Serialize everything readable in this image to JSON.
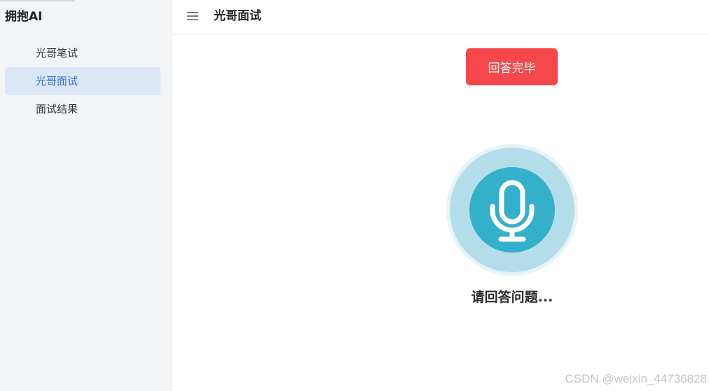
{
  "sidebar": {
    "brand": "拥抱AI",
    "items": [
      {
        "label": "光哥笔试",
        "active": false
      },
      {
        "label": "光哥面试",
        "active": true
      },
      {
        "label": "面试结果",
        "active": false
      }
    ]
  },
  "header": {
    "menu_icon": "hamburger-menu-icon",
    "title": "光哥面试"
  },
  "main": {
    "finish_button_label": "回答完毕",
    "mic_icon": "microphone-icon",
    "status_text": "请回答问题..."
  },
  "watermark": "CSDN @weixin_44736828",
  "colors": {
    "sidebar_bg": "#f3f4f6",
    "active_bg": "#dbe6f7",
    "active_text": "#2f74d6",
    "finish_button": "#f6474b",
    "mic_outer": "#b3dde8",
    "mic_inner": "#34b0cb"
  }
}
